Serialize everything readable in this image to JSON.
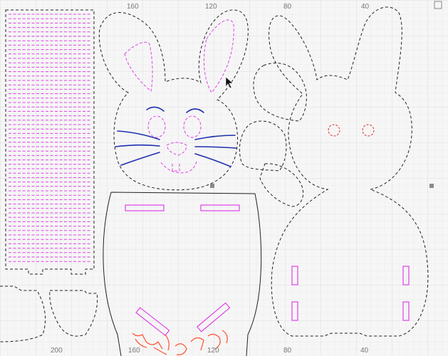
{
  "rulers": {
    "top": [
      "160",
      "120",
      "80",
      "40"
    ],
    "bottom": [
      "200",
      "160",
      "120",
      "80",
      "40"
    ]
  },
  "colors": {
    "background": "#f6f6f6",
    "grid": "#e2e2e2",
    "cut_line": "#222222",
    "score_line": "#e040e8",
    "draw_line": "#1e2fb0",
    "accent_red": "#e23030"
  },
  "icons": {
    "cursor": "mouse-pointer-arrow",
    "handles": "selection-handle"
  }
}
